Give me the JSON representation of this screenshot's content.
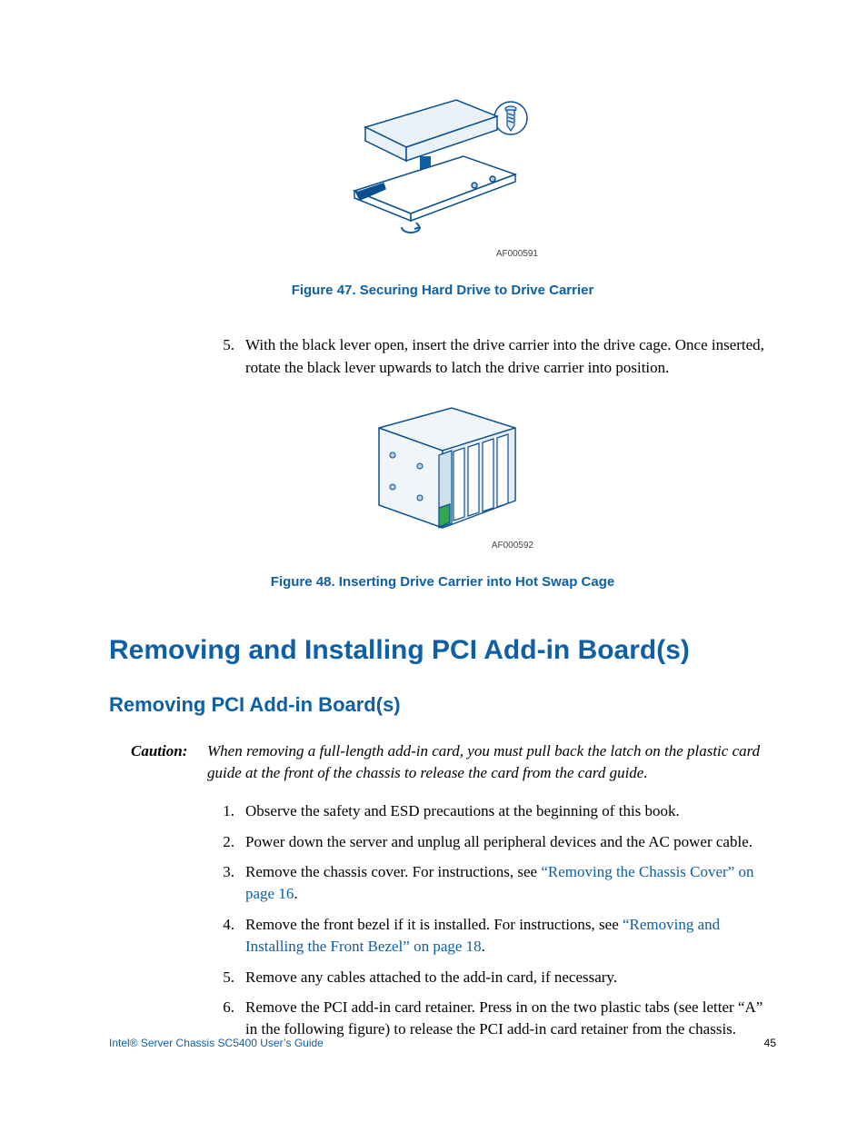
{
  "figure47": {
    "img_code": "AF000591",
    "caption": "Figure 47. Securing Hard Drive to Drive Carrier"
  },
  "step5": {
    "num": "5.",
    "text": "With the black lever open, insert the drive carrier into the drive cage. Once inserted, rotate the black lever upwards to latch the drive carrier into position."
  },
  "figure48": {
    "img_code": "AF000592",
    "caption": "Figure 48. Inserting Drive Carrier into Hot Swap Cage"
  },
  "heading1": "Removing and Installing PCI Add-in Board(s)",
  "heading2": "Removing PCI Add-in Board(s)",
  "caution": {
    "label": "Caution:",
    "text": "When removing a full-length add-in card, you must pull back the latch on the plastic card guide at the front of the chassis to release the card from the card guide."
  },
  "steps": {
    "s1": {
      "num": "1.",
      "text": "Observe the safety and ESD precautions at the beginning of this book."
    },
    "s2": {
      "num": "2.",
      "text": "Power down the server and unplug all peripheral devices and the AC power cable."
    },
    "s3": {
      "num": "3.",
      "pre": "Remove the chassis cover. For instructions, see ",
      "link": "“Removing the Chassis Cover” on page 16",
      "post": "."
    },
    "s4": {
      "num": "4.",
      "pre": "Remove the front bezel if it is installed. For instructions, see ",
      "link": "“Removing and Installing the Front Bezel” on page 18",
      "post": "."
    },
    "s5": {
      "num": "5.",
      "text": "Remove any cables attached to the add-in card, if necessary."
    },
    "s6": {
      "num": "6.",
      "text": "Remove the PCI add-in card retainer. Press in on the two plastic tabs (see letter “A” in the following figure) to release the PCI add-in card retainer from the chassis."
    }
  },
  "footer": {
    "title": "Intel® Server Chassis SC5400 User’s Guide",
    "page": "45"
  }
}
